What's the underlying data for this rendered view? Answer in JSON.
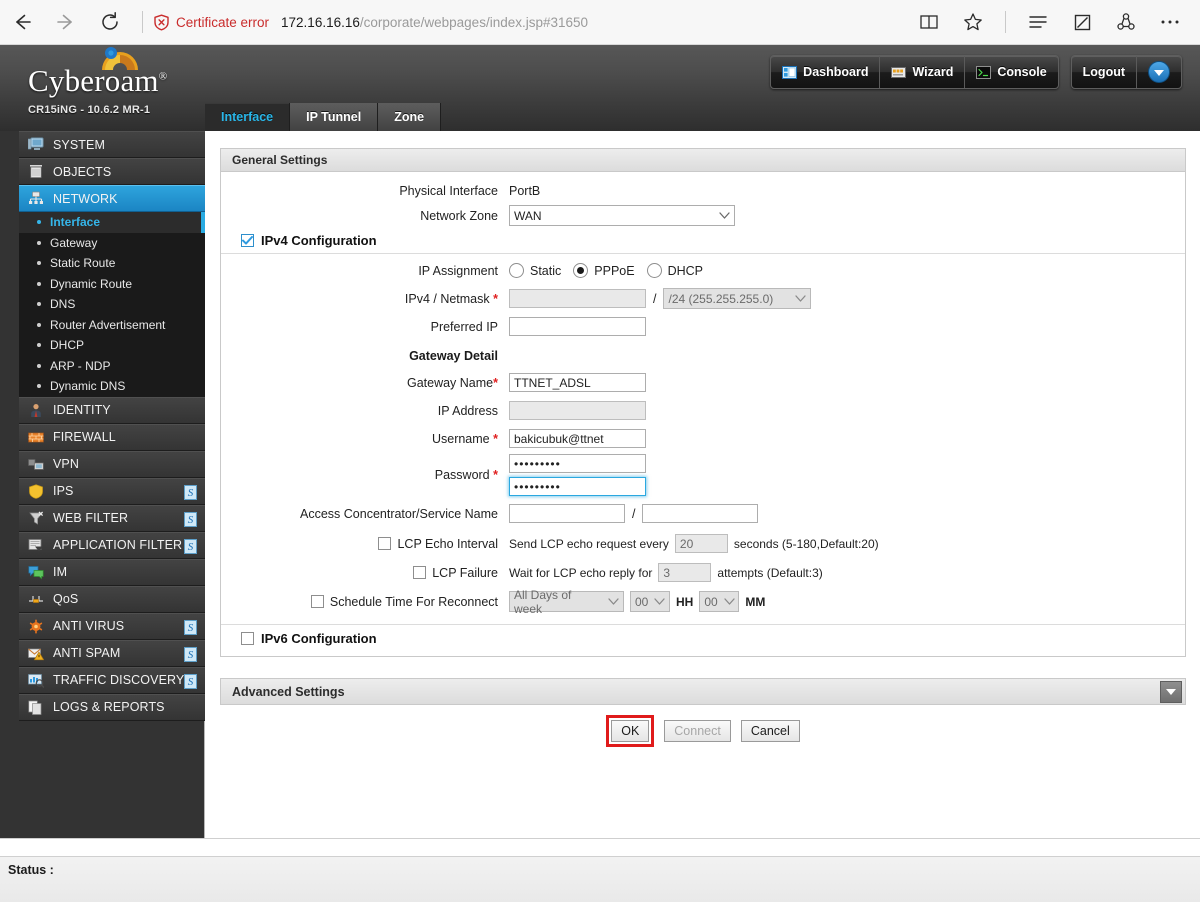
{
  "browser": {
    "back_icon": "back-arrow-icon",
    "forward_icon": "forward-arrow-icon",
    "reload_icon": "reload-icon",
    "certificate_error": "Certificate error",
    "url_host": "172.16.16.16",
    "url_path": "/corporate/webpages/index.jsp#31650",
    "reading_view_icon": "reading-view-icon",
    "favorite_icon": "star-icon",
    "hub_icon": "hub-icon",
    "note_icon": "note-icon",
    "share_icon": "share-icon",
    "more_icon": "more-icon"
  },
  "header": {
    "product": "Cyberoam",
    "registered_mark": "®",
    "model": "CR15iNG - 10.6.2 MR-1",
    "topnav": [
      {
        "label": "Dashboard",
        "icon": "dashboard-icon"
      },
      {
        "label": "Wizard",
        "icon": "wizard-icon"
      },
      {
        "label": "Console",
        "icon": "console-icon"
      }
    ],
    "logout_label": "Logout"
  },
  "tabs": [
    {
      "label": "Interface",
      "active": true
    },
    {
      "label": "IP Tunnel",
      "active": false
    },
    {
      "label": "Zone",
      "active": false
    }
  ],
  "sidebar": {
    "items": [
      {
        "label": "SYSTEM",
        "icon": "system-icon",
        "badge": false
      },
      {
        "label": "OBJECTS",
        "icon": "objects-icon",
        "badge": false
      },
      {
        "label": "NETWORK",
        "icon": "network-icon",
        "badge": false,
        "active": true
      },
      {
        "label": "IDENTITY",
        "icon": "identity-icon",
        "badge": false
      },
      {
        "label": "FIREWALL",
        "icon": "firewall-icon",
        "badge": false
      },
      {
        "label": "VPN",
        "icon": "vpn-icon",
        "badge": false
      },
      {
        "label": "IPS",
        "icon": "ips-icon",
        "badge": true
      },
      {
        "label": "WEB FILTER",
        "icon": "web-filter-icon",
        "badge": true
      },
      {
        "label": "APPLICATION FILTER",
        "icon": "application-filter-icon",
        "badge": true
      },
      {
        "label": "IM",
        "icon": "im-icon",
        "badge": false
      },
      {
        "label": "QoS",
        "icon": "qos-icon",
        "badge": false
      },
      {
        "label": "ANTI VIRUS",
        "icon": "anti-virus-icon",
        "badge": true
      },
      {
        "label": "ANTI SPAM",
        "icon": "anti-spam-icon",
        "badge": true
      },
      {
        "label": "TRAFFIC DISCOVERY",
        "icon": "traffic-discovery-icon",
        "badge": true
      },
      {
        "label": "LOGS & REPORTS",
        "icon": "logs-reports-icon",
        "badge": false
      }
    ],
    "network_submenu": [
      {
        "label": "Interface",
        "current": true
      },
      {
        "label": "Gateway",
        "current": false
      },
      {
        "label": "Static Route",
        "current": false
      },
      {
        "label": "Dynamic Route",
        "current": false
      },
      {
        "label": "DNS",
        "current": false
      },
      {
        "label": "Router Advertisement",
        "current": false
      },
      {
        "label": "DHCP",
        "current": false
      },
      {
        "label": "ARP - NDP",
        "current": false
      },
      {
        "label": "Dynamic DNS",
        "current": false
      }
    ]
  },
  "form": {
    "panel_title": "General Settings",
    "physical_interface": {
      "label": "Physical Interface",
      "value": "PortB"
    },
    "network_zone": {
      "label": "Network Zone",
      "value": "WAN"
    },
    "ipv4_config": {
      "label": "IPv4 Configuration",
      "checked": true
    },
    "ip_assignment": {
      "label": "IP Assignment",
      "options": [
        "Static",
        "PPPoE",
        "DHCP"
      ],
      "selected": "PPPoE"
    },
    "ipv4_netmask": {
      "label": "IPv4 / Netmask",
      "required": "*",
      "value": "",
      "separator": "/",
      "netmask_value": "/24 (255.255.255.0)"
    },
    "preferred_ip": {
      "label": "Preferred IP",
      "value": ""
    },
    "gateway_detail_title": "Gateway Detail",
    "gateway_name": {
      "label": "Gateway Name",
      "required": "*",
      "value": "TTNET_ADSL"
    },
    "ip_address": {
      "label": "IP Address",
      "value": ""
    },
    "username": {
      "label": "Username",
      "required": "*",
      "value": "bakicubuk@ttnet"
    },
    "password": {
      "label": "Password",
      "required": "*",
      "value": "•••••••••",
      "confirm_value": "•••••••••"
    },
    "access_concentrator": {
      "label": "Access Concentrator/Service Name",
      "value": "",
      "separator": "/",
      "service_value": ""
    },
    "lcp_echo_interval": {
      "label": "LCP Echo Interval",
      "checked": false,
      "prefix": "Send LCP echo request every",
      "value": "20",
      "suffix": "seconds (5-180,Default:20)"
    },
    "lcp_failure": {
      "label": "LCP Failure",
      "checked": false,
      "prefix": "Wait for LCP echo reply for",
      "value": "3",
      "suffix": "attempts (Default:3)"
    },
    "schedule_reconnect": {
      "label": "Schedule Time For Reconnect",
      "checked": false,
      "day_value": "All Days of week",
      "hour_value": "00",
      "hour_unit": "HH",
      "minute_value": "00",
      "minute_unit": "MM"
    },
    "ipv6_config": {
      "label": "IPv6 Configuration",
      "checked": false
    },
    "advanced_settings": {
      "label": "Advanced Settings",
      "toggle_icon": "chevron-down-icon"
    },
    "buttons": {
      "ok": "OK",
      "connect": "Connect",
      "cancel": "Cancel",
      "ok_highlight_color": "#e01b1b"
    }
  },
  "status": {
    "label": "Status :"
  }
}
